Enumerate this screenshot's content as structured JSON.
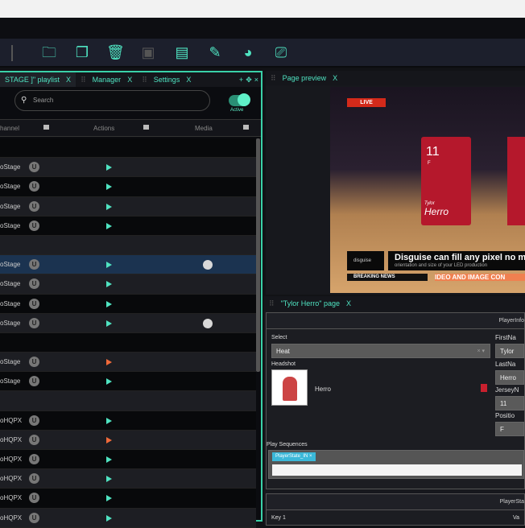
{
  "toolbar": {
    "icons": [
      "folder-add-icon",
      "copy-icon",
      "delete-icon",
      "save-icon",
      "save-edit-icon",
      "pencil-icon",
      "palette-icon",
      "monitor-upload-icon"
    ]
  },
  "left_panel": {
    "tabs": [
      {
        "label": "STAGE ]\" playlist",
        "close": "X"
      },
      {
        "label": "Manager",
        "close": "X"
      },
      {
        "label": "Settings",
        "close": "X"
      }
    ],
    "tab_controls": [
      "+",
      "✥",
      "×"
    ],
    "search_placeholder": "Search",
    "toggle_label": "Active",
    "columns": [
      "hannel",
      "Actions",
      "Media"
    ],
    "rows": [
      {
        "type": "group"
      },
      {
        "name": "oStage",
        "action": "play"
      },
      {
        "name": "oStage",
        "action": "play"
      },
      {
        "name": "oStage",
        "action": "play"
      },
      {
        "name": "oStage",
        "action": "play"
      },
      {
        "type": "group"
      },
      {
        "name": "oStage",
        "action": "play",
        "media": true,
        "selected": true
      },
      {
        "name": "oStage",
        "action": "play"
      },
      {
        "name": "oStage",
        "action": "play"
      },
      {
        "name": "oStage",
        "action": "play",
        "media": true
      },
      {
        "type": "group"
      },
      {
        "name": "oStage",
        "action": "play-warn"
      },
      {
        "name": "oStage",
        "action": "play"
      },
      {
        "type": "group"
      },
      {
        "name": "oHQPX",
        "action": "play"
      },
      {
        "name": "oHQPX",
        "action": "play-warn"
      },
      {
        "name": "oHQPX",
        "action": "play"
      },
      {
        "name": "oHQPX",
        "action": "play"
      },
      {
        "name": "oHQPX",
        "action": "play"
      },
      {
        "name": "oHQPX",
        "action": "play"
      }
    ]
  },
  "preview": {
    "title": "Page preview",
    "close": "X",
    "live": "LIVE",
    "card_number": "11",
    "card_position": "F",
    "card_first": "Tylor",
    "card_last": "Herro",
    "ticker_logo": "disguise",
    "headline": "Disguise can fill any pixel no m",
    "subline": "orientation and size of your LED production",
    "breaking": "BREAKING NEWS",
    "ticker": "IDEO AND IMAGE CON"
  },
  "page_panel": {
    "title": "\"Tylor Herro\" page",
    "close": "X",
    "section1": "PlayerInfo",
    "select_label": "Select",
    "select_value": "Heat",
    "headshot_label": "Headshot",
    "headshot_name": "Herro",
    "firstname_label": "FirstNa",
    "firstname": "Tylor",
    "lastname_label": "LastNa",
    "lastname": "Herro",
    "jersey_label": "JerseyN",
    "jersey": "11",
    "position_label": "Positio",
    "position": "F",
    "sequences_label": "Play Sequences",
    "sequence_tag": "PlayerState_IN",
    "section2": "PlayerSta",
    "key_label": "Key 1",
    "val_label": "Va"
  }
}
